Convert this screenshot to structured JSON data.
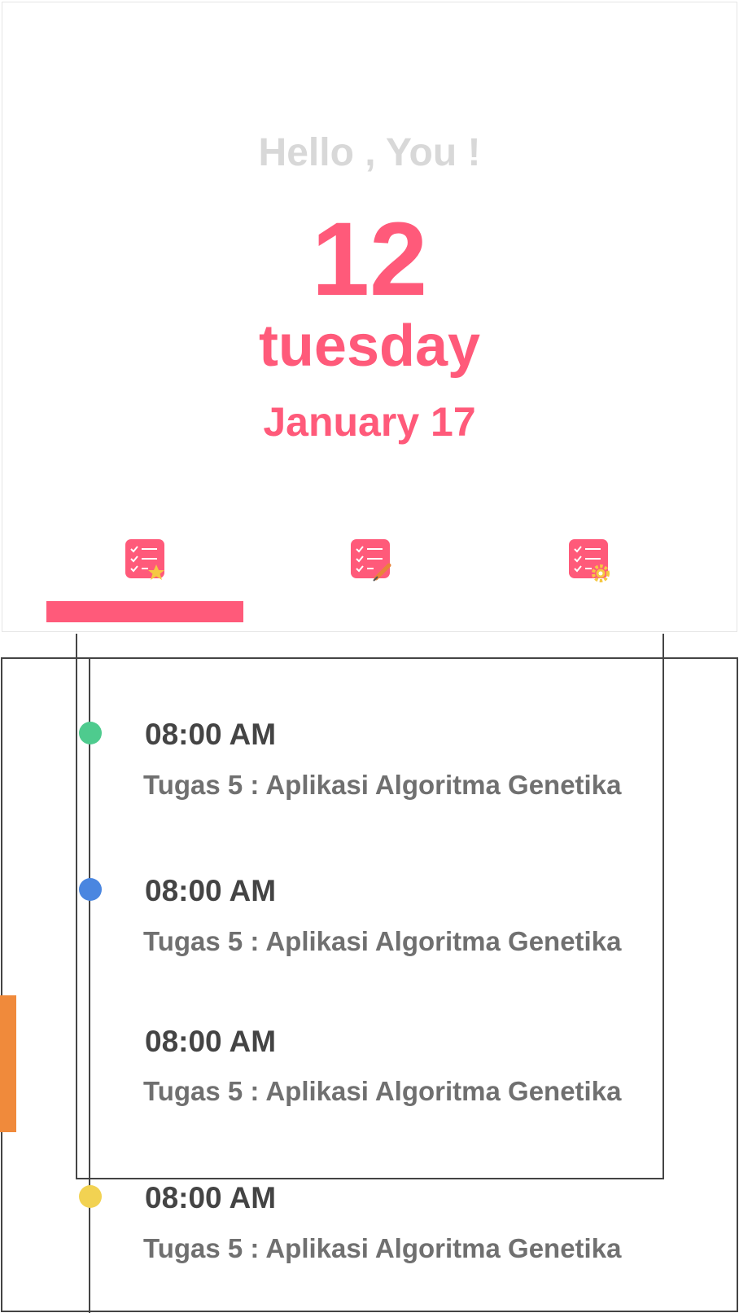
{
  "colors": {
    "accent": "#ff5a7a",
    "greeting": "#d8d8d8",
    "dot_green": "#4ecb8e",
    "dot_blue": "#4a86e0",
    "dot_yellow": "#f2d252",
    "side_tab": "#f08a3b"
  },
  "header": {
    "greeting": "Hello , You !",
    "day_number": "12",
    "weekday": "tuesday",
    "month_date": "January 17"
  },
  "tabs": [
    {
      "icon": "checklist-star-icon",
      "selected": true
    },
    {
      "icon": "checklist-pencil-icon",
      "selected": false
    },
    {
      "icon": "checklist-gear-icon",
      "selected": false
    }
  ],
  "timeline": {
    "items": [
      {
        "time": "08:00 AM",
        "task": "Tugas 5 : Aplikasi Algoritma Genetika",
        "dot_color": "#4ecb8e"
      },
      {
        "time": "08:00 AM",
        "task": "Tugas 5 : Aplikasi Algoritma Genetika",
        "dot_color": "#4a86e0"
      },
      {
        "time": "08:00 AM",
        "task": "Tugas 5 : Aplikasi Algoritma Genetika",
        "dot_color": ""
      },
      {
        "time": "08:00 AM",
        "task": "Tugas 5 : Aplikasi Algoritma Genetika",
        "dot_color": "#f2d252"
      }
    ]
  }
}
